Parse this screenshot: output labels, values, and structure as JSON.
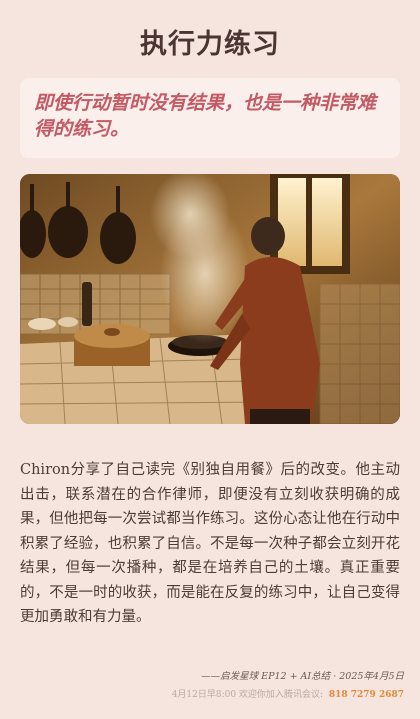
{
  "header": {
    "title": "执行力练习"
  },
  "quote": {
    "text": "即使行动暂时没有结果，也是一种非常难得的练习。"
  },
  "photo": {
    "description_icon": "kitchen-cooking-scene"
  },
  "article": {
    "body": "Chiron分享了自己读完《别独自用餐》后的改变。他主动出击，联系潜在的合作律师，即便没有立刻收获明确的成果，但他把每一次尝试都当作练习。这份心态让他在行动中积累了经验，也积累了自信。不是每一次种子都会立刻开花结果，但每一次播种，都是在培养自己的土壤。真正重要的，不是一时的收获，而是能在反复的练习中，让自己变得更加勇敢和有力量。"
  },
  "credit": {
    "text": "——启发星球 EP12 + AI总结 · 2025年4月5日"
  },
  "footer": {
    "notice": "4月12日早8:00 欢迎你加入腾讯会议: ",
    "meeting_id": "818 7279 2687"
  },
  "colors": {
    "background": "#f6e4de",
    "quote_text": "#c45a63",
    "meeting_id": "#e08a3a"
  }
}
